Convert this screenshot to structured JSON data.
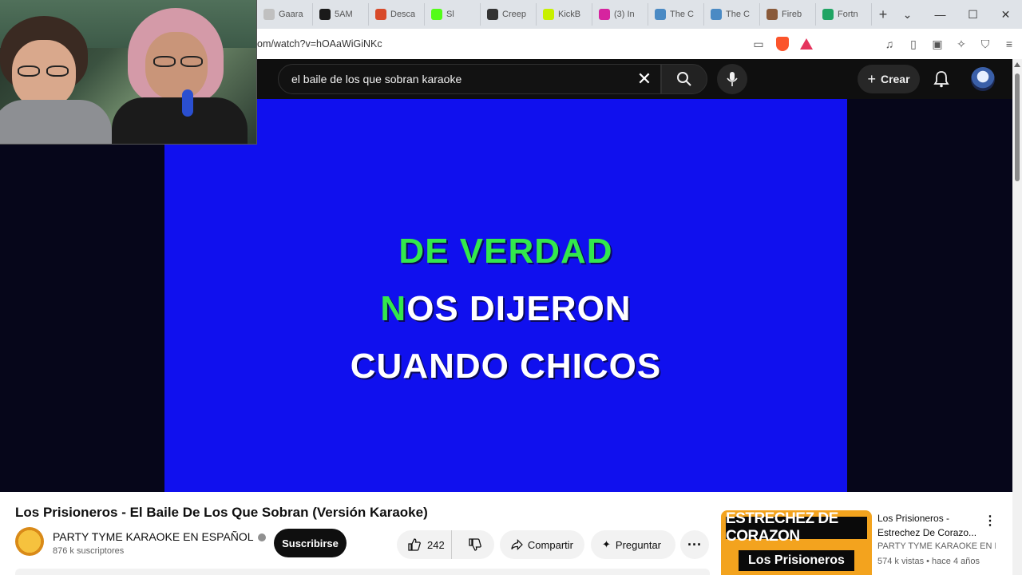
{
  "browser": {
    "tabs": [
      {
        "title": "Gaara",
        "icon": "gaara-favicon",
        "color": "#c0c0c0"
      },
      {
        "title": "5AM",
        "icon": "5am-favicon",
        "color": "#1a1a1a"
      },
      {
        "title": "Desca",
        "icon": "grid-favicon",
        "color": "#d84a2a"
      },
      {
        "title": "Sl",
        "icon": "kick-favicon",
        "color": "#53fc18"
      },
      {
        "title": "Creep",
        "icon": "creep-favicon",
        "color": "#333333"
      },
      {
        "title": "KickB",
        "icon": "kickbot-favicon",
        "color": "#c8f000"
      },
      {
        "title": "(3) In",
        "icon": "instagram-favicon",
        "color": "#d6249f"
      },
      {
        "title": "The C",
        "icon": "the-c-favicon",
        "color": "#4a8ac4"
      },
      {
        "title": "The C",
        "icon": "the-c-favicon",
        "color": "#4a8ac4"
      },
      {
        "title": "Fireb",
        "icon": "monkey-favicon",
        "color": "#8a5a3a"
      },
      {
        "title": "Fortn",
        "icon": "drive-favicon",
        "color": "#1fa463"
      }
    ],
    "new_tab": "+",
    "url": "om/watch?v=hOAaWiGiNKc"
  },
  "youtube": {
    "search_value": "el baile de los que sobran karaoke",
    "create_label": "Crear"
  },
  "video": {
    "lyric_line1": "DE VERDAD",
    "lyric_line2_highlight": "N",
    "lyric_line2_rest": "OS DIJERON",
    "lyric_line3": "CUANDO CHICOS"
  },
  "details": {
    "title": "Los Prisioneros - El Baile De Los Que Sobran (Versión Karaoke)",
    "channel": "PARTY TYME KARAOKE EN ESPAÑOL",
    "subscribers": "876 k suscriptores",
    "subscribe_label": "Suscribirse",
    "likes": "242",
    "share_label": "Compartir",
    "ask_label": "Preguntar"
  },
  "recommendation": {
    "thumb_top": "ESTRECHEZ DE CORAZON",
    "thumb_bottom": "Los Prisioneros",
    "title": "Los Prisioneros - Estrechez De Corazo...",
    "channel": "PARTY TYME KARAOKE EN E...",
    "meta": "574 k vistas • hace 4 años"
  }
}
